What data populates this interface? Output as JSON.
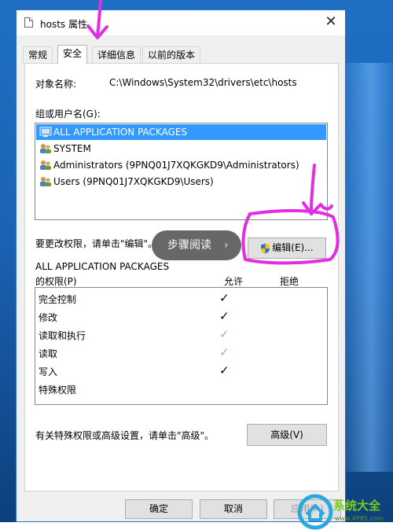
{
  "window": {
    "title": "hosts 属性",
    "close_icon": "close-icon"
  },
  "tabs": [
    {
      "label": "常规"
    },
    {
      "label": "安全",
      "active": true
    },
    {
      "label": "详细信息"
    },
    {
      "label": "以前的版本"
    }
  ],
  "object_name": {
    "label": "对象名称:",
    "value": "C:\\Windows\\System32\\drivers\\etc\\hosts"
  },
  "groups": {
    "label": "组或用户名(G):",
    "items": [
      {
        "name": "ALL APPLICATION PACKAGES",
        "icon": "package-icon",
        "selected": true
      },
      {
        "name": "SYSTEM",
        "icon": "users-icon"
      },
      {
        "name": "Administrators (9PNQ01J7XQKGKD9\\Administrators)",
        "icon": "users-icon"
      },
      {
        "name": "Users (9PNQ01J7XQKGKD9\\Users)",
        "icon": "users-icon"
      }
    ]
  },
  "change_hint": "要更改权限，请单击\"编辑\"。",
  "edit_button": "编辑(E)...",
  "permissions": {
    "title_line1": "ALL APPLICATION PACKAGES",
    "title_line2": "的权限(P)",
    "allow_header": "允许",
    "deny_header": "拒绝",
    "rows": [
      {
        "name": "完全控制",
        "allow": "✓",
        "state": "checked"
      },
      {
        "name": "修改",
        "allow": "✓",
        "state": "checked"
      },
      {
        "name": "读取和执行",
        "allow": "✓",
        "state": "greyed"
      },
      {
        "name": "读取",
        "allow": "✓",
        "state": "greyed"
      },
      {
        "name": "写入",
        "allow": "✓",
        "state": "checked"
      },
      {
        "name": "特殊权限",
        "allow": "",
        "state": "none"
      }
    ]
  },
  "advanced_hint": "有关特殊权限或高级设置，请单击\"高级\"。",
  "advanced_button": "高级(V)",
  "footer": {
    "ok": "确定",
    "cancel": "取消",
    "apply": "应用(A)"
  },
  "overlay": {
    "label": "步骤阅读",
    "arrow": "›"
  },
  "watermark": {
    "text": "系统大全",
    "url": "www.XP85.com"
  },
  "colors": {
    "selection": "#3399ff",
    "annotation": "#e02ee0",
    "wallpaper": "#1f6fc4"
  }
}
